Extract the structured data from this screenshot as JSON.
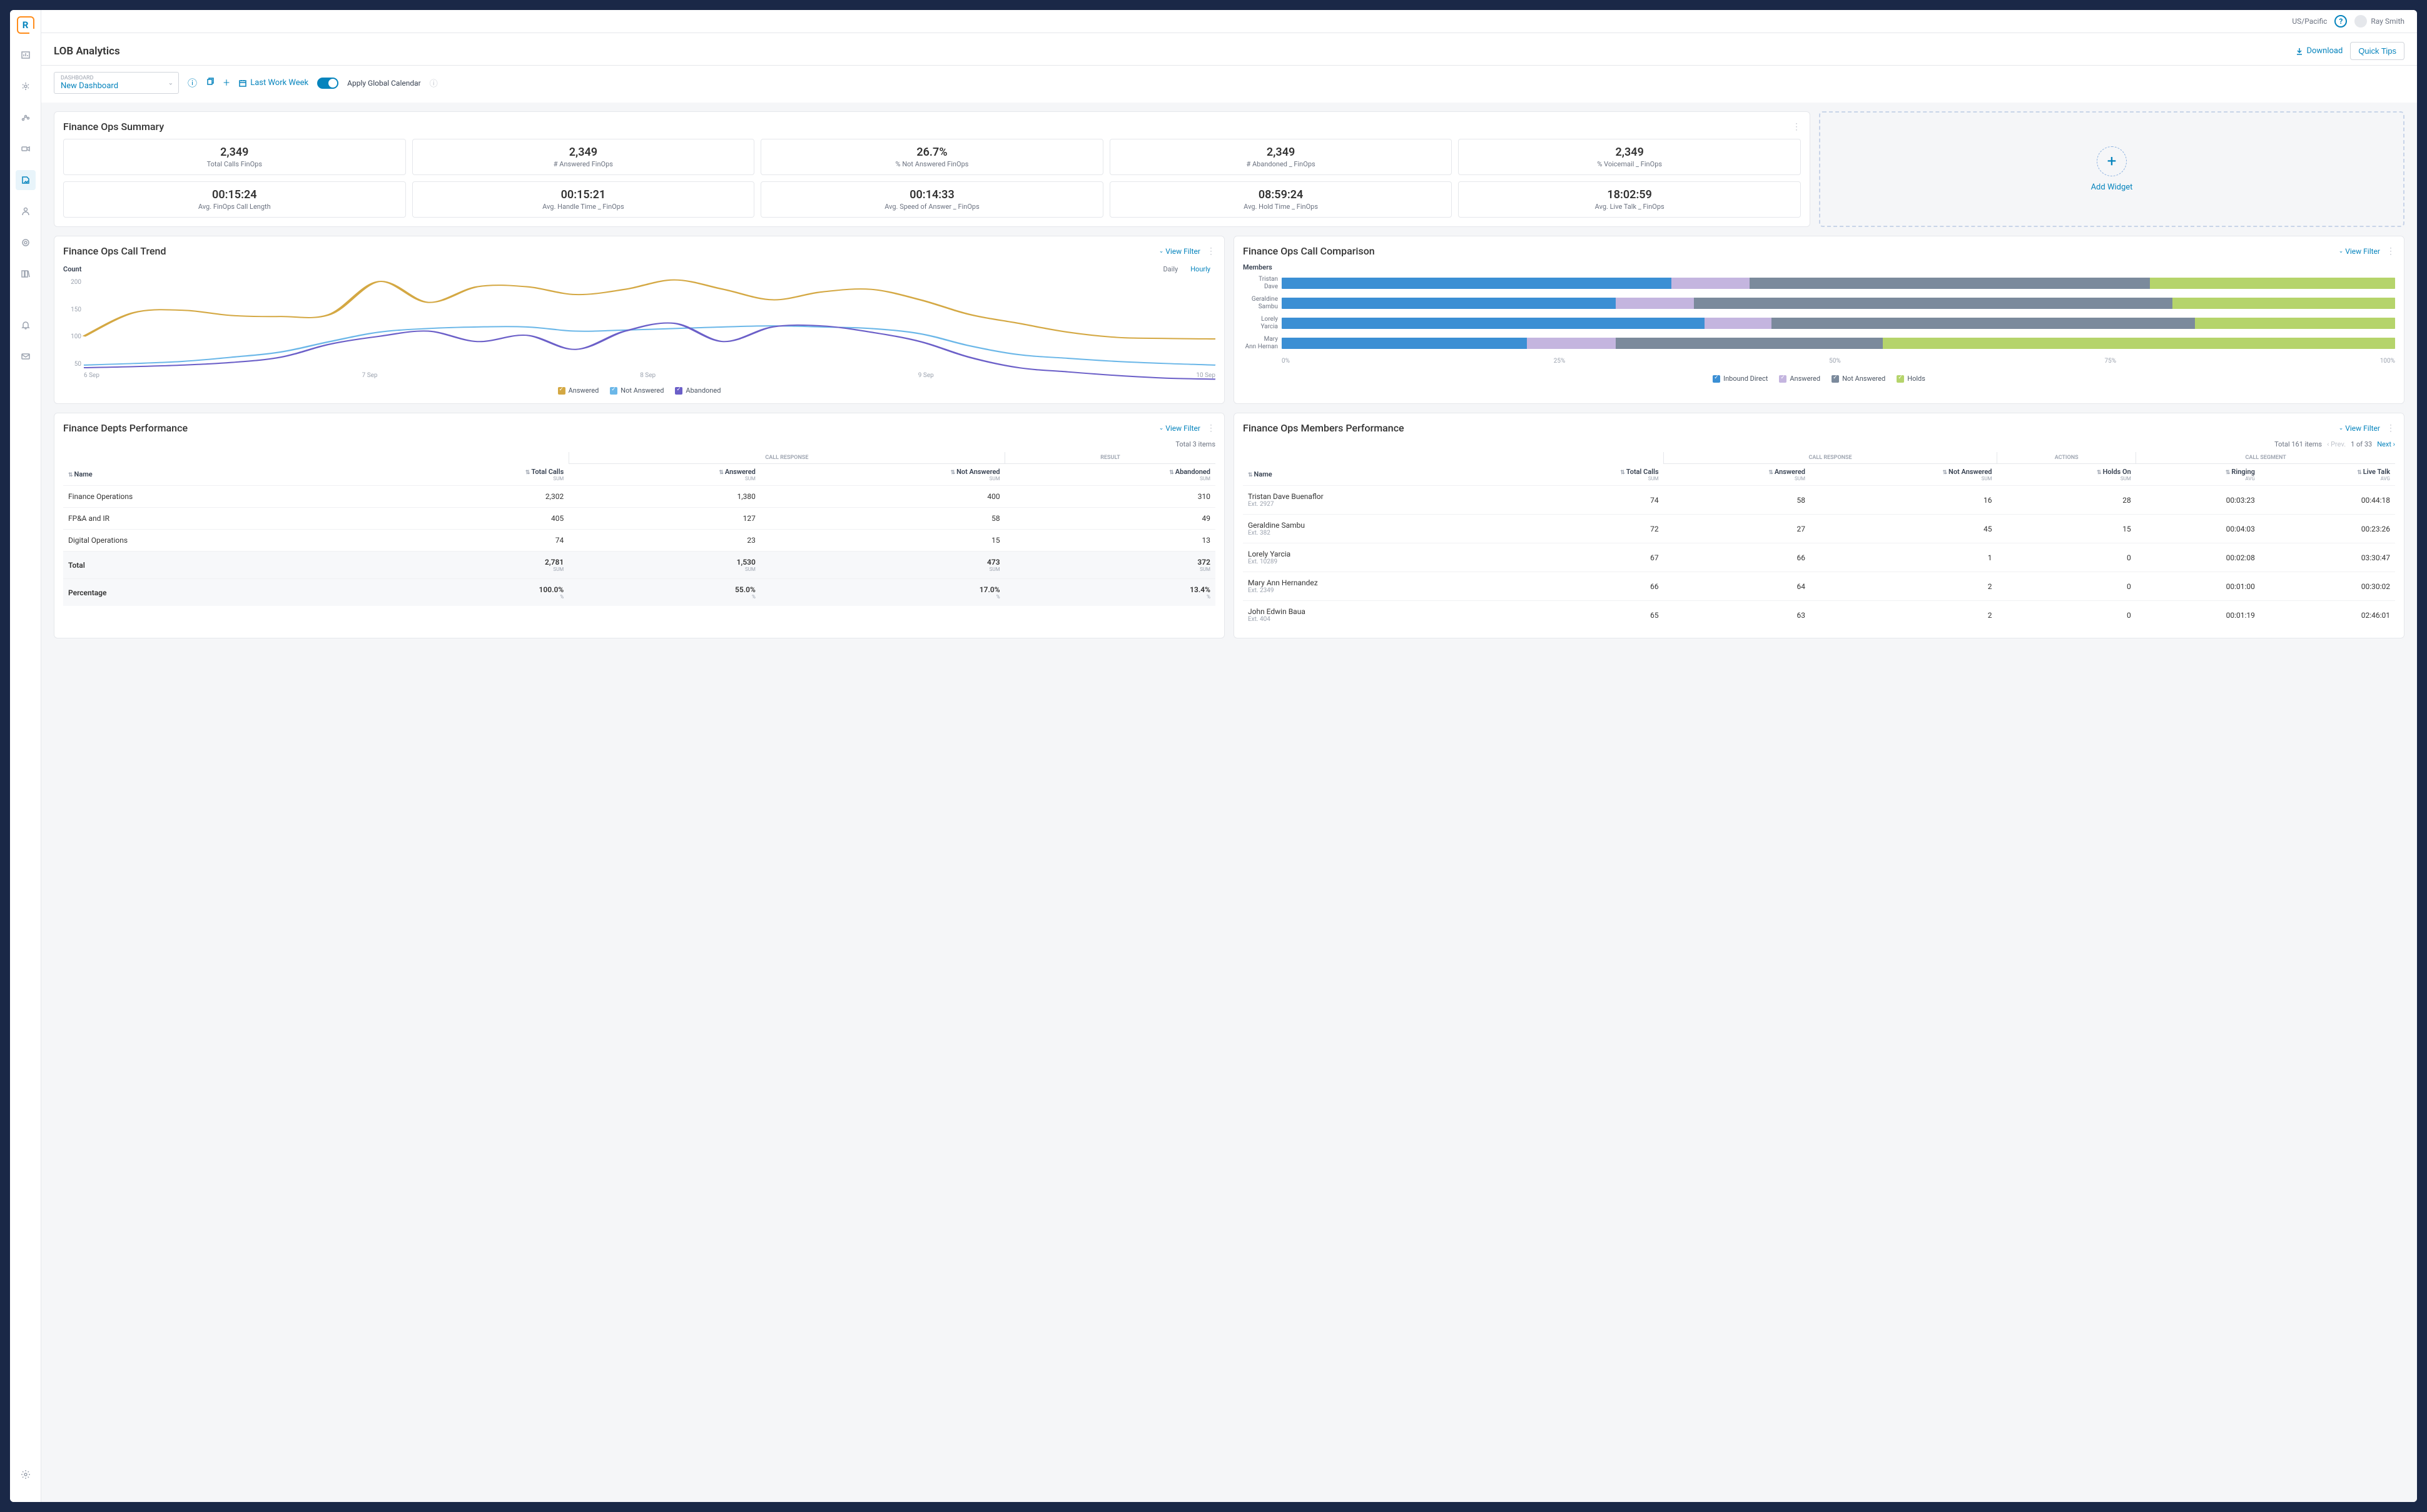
{
  "topbar": {
    "tz": "US/Pacific",
    "user": "Ray Smith"
  },
  "header": {
    "title": "LOB Analytics",
    "download": "Download",
    "quicktips": "Quick Tips"
  },
  "toolbar": {
    "dashboard_label": "DASHBOARD",
    "dashboard_value": "New Dashboard",
    "date_range": "Last Work Week",
    "apply_global": "Apply Global Calendar"
  },
  "summary": {
    "title": "Finance Ops Summary",
    "cards": [
      {
        "v": "2,349",
        "l": "Total Calls FinOps"
      },
      {
        "v": "2,349",
        "l": "# Answered FinOps"
      },
      {
        "v": "26.7%",
        "l": "% Not Answered FinOps"
      },
      {
        "v": "2,349",
        "l": "# Abandoned _ FinOps"
      },
      {
        "v": "2,349",
        "l": "% Voicemail _ FinOps"
      },
      {
        "v": "00:15:24",
        "l": "Avg. FinOps Call Length"
      },
      {
        "v": "00:15:21",
        "l": "Avg. Handle Time _ FinOps"
      },
      {
        "v": "00:14:33",
        "l": "Avg. Speed of Answer _ FinOps"
      },
      {
        "v": "08:59:24",
        "l": "Avg. Hold Time _ FinOps"
      },
      {
        "v": "18:02:59",
        "l": "Avg. Live Talk _ FinOps"
      }
    ]
  },
  "add_widget": "Add Widget",
  "trend": {
    "title": "Finance Ops Call Trend",
    "view_filter": "View Filter",
    "count_label": "Count",
    "seg_daily": "Daily",
    "seg_hourly": "Hourly",
    "legend": [
      "Answered",
      "Not Answered",
      "Abandoned"
    ]
  },
  "comparison": {
    "title": "Finance Ops Call Comparison",
    "view_filter": "View Filter",
    "members_label": "Members",
    "legend": [
      "Inbound Direct",
      "Answered",
      "Not Answered",
      "Holds"
    ]
  },
  "depts": {
    "title": "Finance Depts Performance",
    "view_filter": "View Filter",
    "total_items": "Total 3 items",
    "group_headers": {
      "response": "CALL RESPONSE",
      "result": "RESULT"
    },
    "cols": {
      "name": "Name",
      "total": "Total Calls",
      "answered": "Answered",
      "not_answered": "Not Answered",
      "abandoned": "Abandoned",
      "sub": "SUM"
    },
    "rows": [
      {
        "name": "Finance Operations",
        "total": "2,302",
        "ans": "1,380",
        "nans": "400",
        "ab": "310"
      },
      {
        "name": "FP&A and IR",
        "total": "405",
        "ans": "127",
        "nans": "58",
        "ab": "49"
      },
      {
        "name": "Digital Operations",
        "total": "74",
        "ans": "23",
        "nans": "15",
        "ab": "13"
      }
    ],
    "total_row": {
      "label": "Total",
      "total": "2,781",
      "ans": "1,530",
      "nans": "473",
      "ab": "372"
    },
    "pct_row": {
      "label": "Percentage",
      "total": "100.0%",
      "ans": "55.0%",
      "nans": "17.0%",
      "ab": "13.4%"
    }
  },
  "members": {
    "title": "Finance Ops Members Performance",
    "view_filter": "View Filter",
    "total_items": "Total 161 items",
    "prev": "Prev.",
    "page": "1 of 33",
    "next": "Next",
    "group_headers": {
      "response": "CALL RESPONSE",
      "actions": "ACTIONS",
      "segment": "CALL SEGMENT"
    },
    "cols": {
      "name": "Name",
      "total": "Total Calls",
      "answered": "Answered",
      "not_answered": "Not Answered",
      "holds": "Holds On",
      "ringing": "Ringing",
      "live": "Live Talk",
      "sum": "SUM",
      "avg": "AVG"
    },
    "rows": [
      {
        "name": "Tristan Dave Buenaflor",
        "ext": "Ext. 2927",
        "total": "74",
        "ans": "58",
        "nans": "16",
        "holds": "28",
        "ring": "00:03:23",
        "live": "00:44:18"
      },
      {
        "name": "Geraldine Sambu",
        "ext": "Ext. 382",
        "total": "72",
        "ans": "27",
        "nans": "45",
        "holds": "15",
        "ring": "00:04:03",
        "live": "00:23:26"
      },
      {
        "name": "Lorely Yarcia",
        "ext": "Ext. 10289",
        "total": "67",
        "ans": "66",
        "nans": "1",
        "holds": "0",
        "ring": "00:02:08",
        "live": "03:30:47"
      },
      {
        "name": "Mary Ann Hernandez",
        "ext": "Ext. 2349",
        "total": "66",
        "ans": "64",
        "nans": "2",
        "holds": "0",
        "ring": "00:01:00",
        "live": "00:30:02"
      },
      {
        "name": "John Edwin Baua",
        "ext": "Ext. 404",
        "total": "65",
        "ans": "63",
        "nans": "2",
        "holds": "0",
        "ring": "00:01:19",
        "live": "02:46:01"
      }
    ]
  },
  "chart_data": [
    {
      "type": "line",
      "title": "Finance Ops Call Trend",
      "ylabel": "Count",
      "ylim": [
        50,
        200
      ],
      "x": [
        "6 Sep",
        "7 Sep",
        "8 Sep",
        "9 Sep",
        "10 Sep"
      ],
      "series": [
        {
          "name": "Answered",
          "color": "#d4a843",
          "values_per_hour": [
            110,
            155,
            160,
            150,
            148,
            152,
            215,
            175,
            205,
            205,
            190,
            200,
            218,
            200,
            180,
            195,
            200,
            180,
            152,
            135,
            118,
            108,
            106,
            105
          ]
        },
        {
          "name": "Not Answered",
          "color": "#6bb7e8",
          "values_per_hour": [
            55,
            58,
            62,
            70,
            80,
            100,
            118,
            125,
            128,
            128,
            120,
            122,
            125,
            128,
            130,
            128,
            125,
            115,
            92,
            75,
            68,
            62,
            58,
            55
          ]
        },
        {
          "name": "Abandoned",
          "color": "#6b5fc8",
          "values_per_hour": [
            50,
            52,
            55,
            60,
            70,
            95,
            110,
            120,
            100,
            112,
            85,
            120,
            135,
            100,
            128,
            130,
            118,
            100,
            70,
            50,
            42,
            35,
            30,
            28
          ]
        }
      ]
    },
    {
      "type": "bar",
      "orientation": "horizontal-stacked",
      "title": "Finance Ops Call Comparison",
      "xlabel": "%",
      "xlim": [
        0,
        100
      ],
      "categories": [
        "Tristan Dave",
        "Geraldine Sambu",
        "Lorely Yarcia",
        "Mary Ann Hernan"
      ],
      "series": [
        {
          "name": "Inbound Direct",
          "color": "#3b8fd4",
          "values": [
            35,
            30,
            38,
            22
          ]
        },
        {
          "name": "Answered",
          "color": "#c4b5df",
          "values": [
            7,
            7,
            6,
            8
          ]
        },
        {
          "name": "Not Answered",
          "color": "#7b8a9c",
          "values": [
            36,
            43,
            38,
            24
          ]
        },
        {
          "name": "Holds",
          "color": "#b5d46b",
          "values": [
            22,
            20,
            18,
            46
          ]
        }
      ]
    }
  ]
}
